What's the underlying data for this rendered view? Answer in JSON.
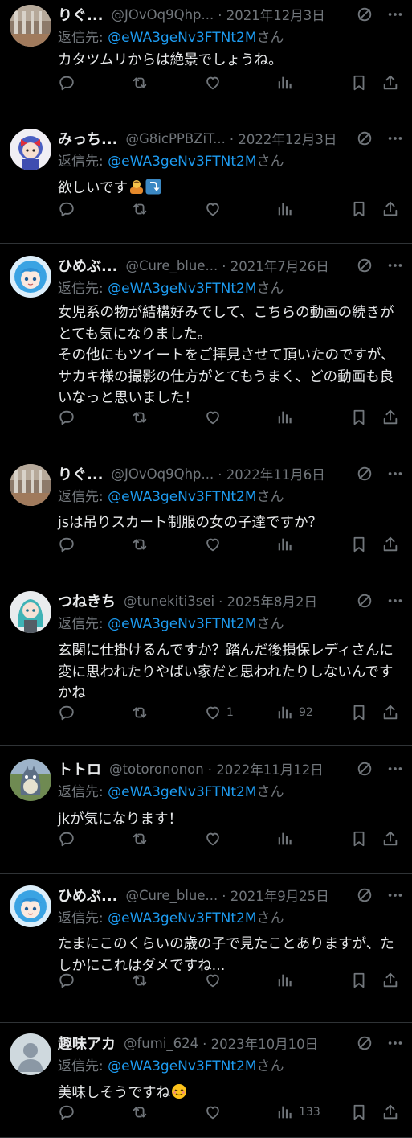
{
  "replies": [
    {
      "display_name": "りぐ...",
      "handle": "@JOvOq9Qhp...",
      "date": "· 2021年12月3日",
      "reply_prefix": "返信先: ",
      "reply_handle": "@eWA3geNv3FTNt2M",
      "reply_suffix": "さん",
      "text": "カタツムリからは絶景でしょうね。",
      "likes": "",
      "views": "",
      "avatar": "gate-photo"
    },
    {
      "display_name": "みっち...",
      "handle": "@G8icPPBZiT...",
      "date": "· 2022年12月3日",
      "reply_prefix": "返信先: ",
      "reply_handle": "@eWA3geNv3FTNt2M",
      "reply_suffix": "さん",
      "text": "欲しいです",
      "emojis": [
        "person-bowing-emoji",
        "arrow-curving-down-emoji"
      ],
      "likes": "",
      "views": "",
      "avatar": "anime-girl-red-bow"
    },
    {
      "display_name": "ひめぶ...",
      "handle": "@Cure_blue...",
      "date": "· 2021年7月26日",
      "reply_prefix": "返信先: ",
      "reply_handle": "@eWA3geNv3FTNt2M",
      "reply_suffix": "さん",
      "text": "女児系の物が結構好みでして、こちらの動画の続きがとても気になりました。\nその他にもツイートをご拝見させて頂いたのですが、サカキ様の撮影の仕方がとてもうまく、どの動画も良いなっと思いました！",
      "likes": "",
      "views": "",
      "avatar": "anime-girl-blue-hair"
    },
    {
      "display_name": "りぐ...",
      "handle": "@JOvOq9Qhp...",
      "date": "· 2022年11月6日",
      "reply_prefix": "返信先: ",
      "reply_handle": "@eWA3geNv3FTNt2M",
      "reply_suffix": "さん",
      "text": "jsは吊りスカート制服の女の子達ですか？",
      "likes": "",
      "views": "",
      "avatar": "gate-photo"
    },
    {
      "display_name": "つねきち",
      "handle": "@tunekiti3sei",
      "date": "· 2025年8月2日",
      "reply_prefix": "返信先: ",
      "reply_handle": "@eWA3geNv3FTNt2M",
      "reply_suffix": "さん",
      "text": "玄関に仕掛けるんですか？踏んだ後損保レディさんに変に思われたりやばい家だと思われたりしないんですかね",
      "likes": "1",
      "views": "92",
      "avatar": "teal-figure"
    },
    {
      "display_name": "トトロ",
      "handle": "@totorononon",
      "date": "· 2022年11月12日",
      "reply_prefix": "返信先: ",
      "reply_handle": "@eWA3geNv3FTNt2M",
      "reply_suffix": "さん",
      "text": "jkが気になります！",
      "likes": "",
      "views": "",
      "avatar": "totoro"
    },
    {
      "display_name": "ひめぶ...",
      "handle": "@Cure_blue...",
      "date": "· 2021年9月25日",
      "reply_prefix": "返信先: ",
      "reply_handle": "@eWA3geNv3FTNt2M",
      "reply_suffix": "さん",
      "text": "たまにこのくらいの歳の子で見たことありますが、たしかにこれはダメですね...",
      "likes": "",
      "views": "",
      "avatar": "anime-girl-blue-hair"
    },
    {
      "display_name": "趣味アカ",
      "handle": "@fumi_624",
      "date": "· 2023年10月10日",
      "reply_prefix": "返信先: ",
      "reply_handle": "@eWA3geNv3FTNt2M",
      "reply_suffix": "さん",
      "text": "美味しそうですね",
      "emojis": [
        "relieved-face-emoji"
      ],
      "likes": "",
      "views": "133",
      "avatar": "default-person"
    }
  ],
  "colors": {
    "background": "#000000",
    "text": "#e7e9ea",
    "muted": "#71767b",
    "link": "#1d9bf0",
    "divider": "#2f3336"
  }
}
